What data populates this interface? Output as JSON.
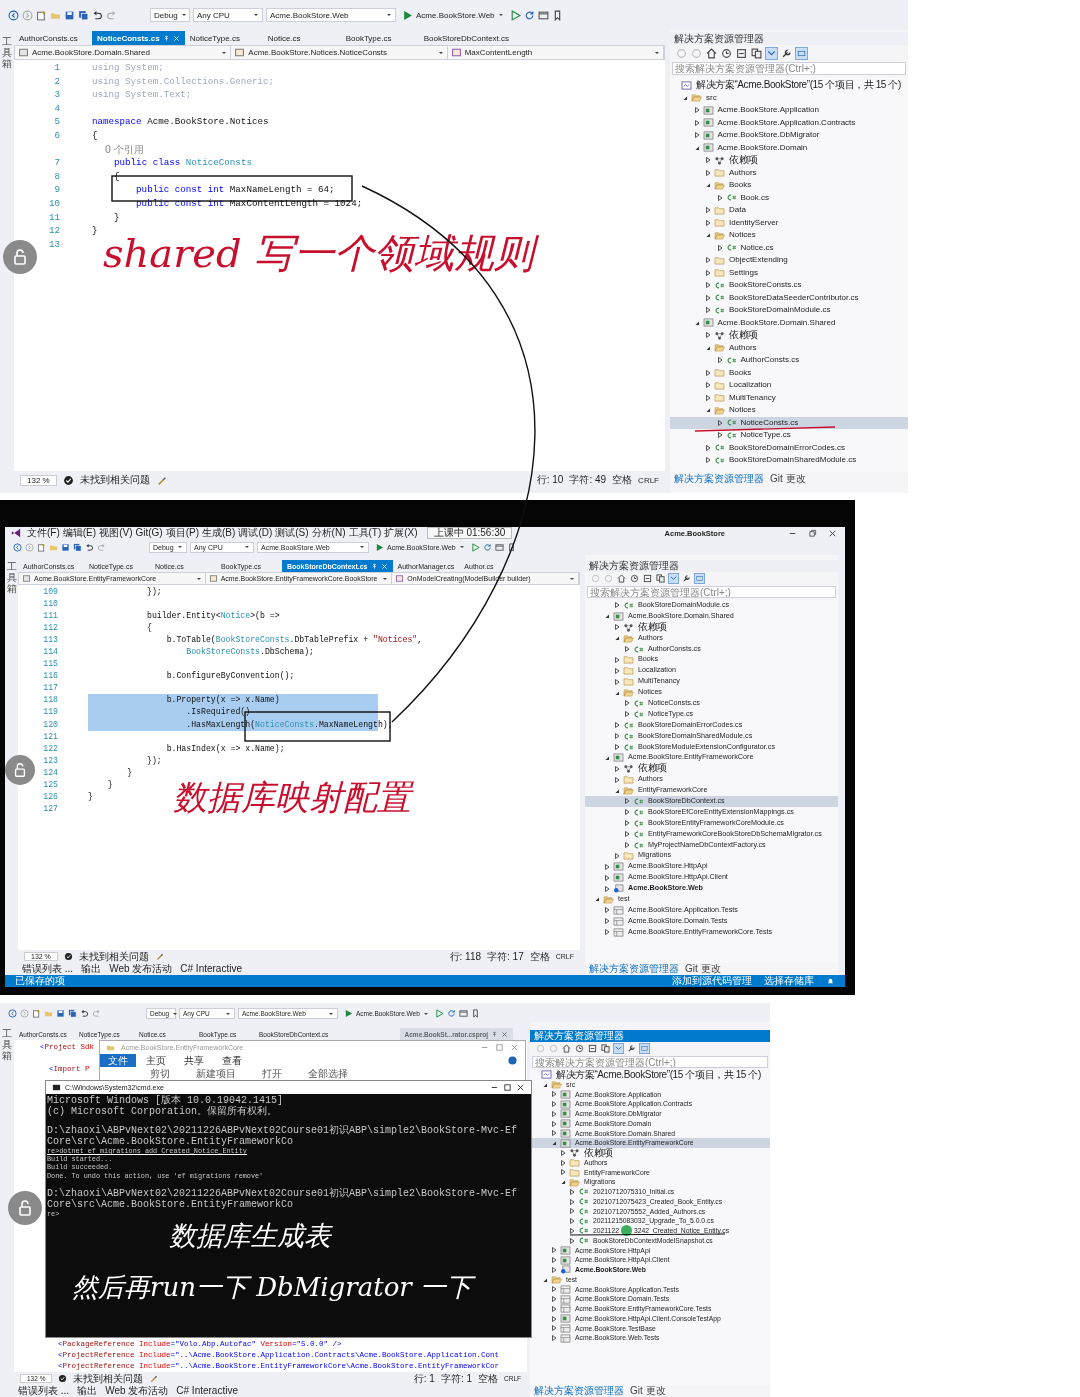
{
  "panels": [
    {
      "toolbar": {
        "config": "Debug",
        "platform": "Any CPU",
        "startup": "Acme.BookStore.Web",
        "run": "Acme.BookStore.Web"
      },
      "side_label": "工具箱",
      "tabs": [
        {
          "label": "AuthorConsts.cs",
          "selected": false
        },
        {
          "label": "NoticeConsts.cs",
          "selected": true
        },
        {
          "label": "NoticeType.cs",
          "selected": false
        },
        {
          "label": "Notice.cs",
          "selected": false
        },
        {
          "label": "BookType.cs",
          "selected": false
        },
        {
          "label": "BookStoreDbContext.cs",
          "selected": false
        }
      ],
      "nav": [
        "Acme.BookStore.Domain.Shared",
        "Acme.BookStore.Notices.NoticeConsts",
        "MaxContentLength"
      ],
      "code": [
        {
          "kind": "code",
          "num": "1",
          "segs": [
            {
              "t": "using System;",
              "kind": "dim"
            }
          ]
        },
        {
          "kind": "code",
          "num": "2",
          "segs": [
            {
              "t": "using System.Collections.Generic;",
              "kind": "dim"
            }
          ]
        },
        {
          "kind": "code",
          "num": "3",
          "segs": [
            {
              "t": "using System.Text;",
              "kind": "dim"
            }
          ]
        },
        {
          "kind": "code",
          "num": "4"
        },
        {
          "kind": "code",
          "num": "5",
          "segs": [
            {
              "t": "namespace",
              "kind": "kw"
            },
            {
              "t": " Acme.BookStore.Notices",
              "kind": "plain"
            }
          ]
        },
        {
          "kind": "code",
          "num": "6",
          "segs": [
            {
              "t": "{",
              "kind": "plain"
            }
          ]
        },
        {
          "kind": "lens",
          "text": "    0 个引用"
        },
        {
          "kind": "code",
          "num": "7",
          "segs": [
            {
              "t": "    public class",
              "kind": "kw"
            },
            {
              "t": " NoticeConsts",
              "kind": "type"
            }
          ]
        },
        {
          "kind": "code",
          "num": "8",
          "segs": [
            {
              "t": "    {",
              "kind": "plain"
            }
          ]
        },
        {
          "kind": "code",
          "num": "9",
          "segs": [
            {
              "t": "        public const int",
              "kind": "kw"
            },
            {
              "t": " MaxNameLength = 64;",
              "kind": "plain"
            }
          ]
        },
        {
          "kind": "code",
          "num": "10",
          "segs": [
            {
              "t": "        public const int",
              "kind": "kw"
            },
            {
              "t": " MaxContentLength = 1024;",
              "kind": "plain"
            }
          ]
        },
        {
          "kind": "code",
          "num": "11",
          "segs": [
            {
              "t": "    }",
              "kind": "plain"
            }
          ]
        },
        {
          "kind": "code",
          "num": "12",
          "segs": [
            {
              "t": "}",
              "kind": "plain"
            }
          ]
        },
        {
          "kind": "code",
          "num": "13"
        }
      ],
      "status": {
        "zoom": "132 %",
        "issues": "未找到相关问题",
        "line": "行: 10",
        "col": "字符: 49",
        "indent": "空格",
        "eol": "CRLF"
      },
      "explorer": {
        "title": "解决方案资源管理器",
        "active": false,
        "search": {
          "placeholder": "搜索解决方案资源管理器(Ctrl+;)"
        },
        "tree": [
          {
            "label": "解决方案“Acme.BookStore”(15 个项目，共 15 个)",
            "kind": "solution",
            "selected": false,
            "children": [
              {
                "label": "src",
                "kind": "folder",
                "expanded": true,
                "selected": false,
                "children": [
                  {
                    "label": "Acme.BookStore.Application",
                    "kind": "project",
                    "expanded": false,
                    "selected": false
                  },
                  {
                    "label": "Acme.BookStore.Application.Contracts",
                    "kind": "project",
                    "expanded": false,
                    "selected": false
                  },
                  {
                    "label": "Acme.BookStore.DbMigrator",
                    "kind": "project",
                    "expanded": false,
                    "selected": false
                  },
                  {
                    "label": "Acme.BookStore.Domain",
                    "kind": "project",
                    "expanded": true,
                    "selected": false,
                    "children": [
                      {
                        "label": "依赖项",
                        "kind": "deps",
                        "expanded": false,
                        "selected": false
                      },
                      {
                        "label": "Authors",
                        "kind": "folder",
                        "expanded": false,
                        "selected": false
                      },
                      {
                        "label": "Books",
                        "kind": "folder",
                        "expanded": true,
                        "selected": false,
                        "children": [
                          {
                            "label": "Book.cs",
                            "kind": "cs",
                            "expanded": false,
                            "selected": false
                          }
                        ]
                      },
                      {
                        "label": "Data",
                        "kind": "folder",
                        "expanded": false,
                        "selected": false
                      },
                      {
                        "label": "IdentityServer",
                        "kind": "folder",
                        "expanded": false,
                        "selected": false
                      },
                      {
                        "label": "Notices",
                        "kind": "folder",
                        "expanded": true,
                        "selected": false,
                        "children": [
                          {
                            "label": "Notice.cs",
                            "kind": "cs",
                            "expanded": false,
                            "selected": false
                          }
                        ]
                      },
                      {
                        "label": "ObjectExtending",
                        "kind": "folder",
                        "expanded": false,
                        "selected": false
                      },
                      {
                        "label": "Settings",
                        "kind": "folder",
                        "expanded": false,
                        "selected": false
                      },
                      {
                        "label": "BookStoreConsts.cs",
                        "kind": "cs",
                        "expanded": false,
                        "selected": false
                      },
                      {
                        "label": "BookStoreDataSeederContributor.cs",
                        "kind": "cs",
                        "expanded": false,
                        "selected": false
                      },
                      {
                        "label": "BookStoreDomainModule.cs",
                        "kind": "cs",
                        "expanded": false,
                        "selected": false
                      }
                    ]
                  },
                  {
                    "label": "Acme.BookStore.Domain.Shared",
                    "kind": "project",
                    "expanded": true,
                    "selected": false,
                    "children": [
                      {
                        "label": "依赖项",
                        "kind": "deps",
                        "expanded": false,
                        "selected": false
                      },
                      {
                        "label": "Authors",
                        "kind": "folder",
                        "expanded": true,
                        "selected": false,
                        "children": [
                          {
                            "label": "AuthorConsts.cs",
                            "kind": "cs",
                            "expanded": false,
                            "selected": false
                          }
                        ]
                      },
                      {
                        "label": "Books",
                        "kind": "folder",
                        "expanded": false,
                        "selected": false
                      },
                      {
                        "label": "Localization",
                        "kind": "folder",
                        "expanded": false,
                        "selected": false
                      },
                      {
                        "label": "MultiTenancy",
                        "kind": "folder",
                        "expanded": false,
                        "selected": false
                      },
                      {
                        "label": "Notices",
                        "kind": "folder",
                        "expanded": true,
                        "selected": false,
                        "children": [
                          {
                            "label": "NoticeConsts.cs",
                            "kind": "cs",
                            "expanded": false,
                            "selected": true
                          },
                          {
                            "label": "NoticeType.cs",
                            "kind": "cs",
                            "expanded": false,
                            "selected": false
                          }
                        ]
                      },
                      {
                        "label": "BookStoreDomainErrorCodes.cs",
                        "kind": "cs",
                        "expanded": false,
                        "selected": false
                      },
                      {
                        "label": "BookStoreDomainSharedModule.cs",
                        "kind": "cs",
                        "expanded": false,
                        "selected": false
                      }
                    ]
                  }
                ]
              }
            ]
          }
        ],
        "tabs": [
          {
            "label": "解决方案资源管理器",
            "selected": true
          },
          {
            "label": "Git 更改",
            "selected": false
          }
        ]
      },
      "handwriting": "shared 写一个领域规则"
    },
    {
      "title_bar": {
        "menu": [
          "文件(F)",
          "编辑(E)",
          "视图(V)",
          "Git(G)",
          "项目(P)",
          "生成(B)",
          "调试(D)",
          "测试(S)",
          "分析(N)",
          "工具(T)",
          "扩展(X)"
        ],
        "timer": "上课中 01:56:30",
        "title": "Acme.BookStore"
      },
      "toolbar": {
        "config": "Debug",
        "platform": "Any CPU",
        "startup": "Acme.BookStore.Web",
        "run": "Acme.BookStore.Web"
      },
      "side_label": "工具箱",
      "tabs": [
        {
          "label": "AuthorConsts.cs",
          "selected": false
        },
        {
          "label": "NoticeType.cs",
          "selected": false
        },
        {
          "label": "Notice.cs",
          "selected": false
        },
        {
          "label": "BookType.cs",
          "selected": false
        },
        {
          "label": "BookStoreDbContext.cs",
          "selected": true
        },
        {
          "label": "AuthorManager.cs",
          "selected": false
        },
        {
          "label": "Author.cs",
          "selected": false
        }
      ],
      "nav": [
        "Acme.BookStore.EntityFrameworkCore",
        "Acme.BookStore.EntityFrameworkCore.BookStore",
        "OnModelCreating(ModelBuilder builder)"
      ],
      "code": [
        {
          "kind": "code",
          "num": "109",
          "highlighted": false,
          "segs": [
            {
              "t": "            });",
              "kind": "plain"
            }
          ]
        },
        {
          "kind": "code",
          "num": "110",
          "highlighted": false
        },
        {
          "kind": "code",
          "num": "111",
          "highlighted": false,
          "segs": [
            {
              "t": "            builder.Entity<",
              "kind": "plain"
            },
            {
              "t": "Notice",
              "kind": "type"
            },
            {
              "t": ">(b =>",
              "kind": "plain"
            }
          ]
        },
        {
          "kind": "code",
          "num": "112",
          "highlighted": false,
          "segs": [
            {
              "t": "            {",
              "kind": "plain"
            }
          ]
        },
        {
          "kind": "code",
          "num": "113",
          "highlighted": false,
          "segs": [
            {
              "t": "                b.ToTable(",
              "kind": "plain"
            },
            {
              "t": "BookStoreConsts",
              "kind": "type"
            },
            {
              "t": ".DbTablePrefix + ",
              "kind": "plain"
            },
            {
              "t": "\"Notices\"",
              "kind": "str"
            },
            {
              "t": ",",
              "kind": "plain"
            }
          ]
        },
        {
          "kind": "code",
          "num": "114",
          "highlighted": false,
          "segs": [
            {
              "t": "                    BookStoreConsts",
              "kind": "type"
            },
            {
              "t": ".DbSchema);",
              "kind": "plain"
            }
          ]
        },
        {
          "kind": "code",
          "num": "115",
          "highlighted": false
        },
        {
          "kind": "code",
          "num": "116",
          "highlighted": false,
          "segs": [
            {
              "t": "                b.ConfigureByConvention();",
              "kind": "plain"
            }
          ]
        },
        {
          "kind": "code",
          "num": "117",
          "highlighted": false
        },
        {
          "kind": "code",
          "num": "118",
          "highlighted": true,
          "segs": [
            {
              "t": "                b.Property(x => x.Name)",
              "kind": "plain"
            }
          ]
        },
        {
          "kind": "code",
          "num": "119",
          "highlighted": true,
          "segs": [
            {
              "t": "                    .IsRequired()",
              "kind": "plain"
            }
          ]
        },
        {
          "kind": "code",
          "num": "120",
          "highlighted": true,
          "segs": [
            {
              "t": "                    .HasMaxLength(",
              "kind": "plain"
            },
            {
              "t": "NoticeConsts",
              "kind": "type"
            },
            {
              "t": ".MaxNameLength);",
              "kind": "plain"
            }
          ]
        },
        {
          "kind": "code",
          "num": "121",
          "highlighted": false
        },
        {
          "kind": "code",
          "num": "122",
          "highlighted": false,
          "segs": [
            {
              "t": "                b.HasIndex(x => x.Name);",
              "kind": "plain"
            }
          ]
        },
        {
          "kind": "code",
          "num": "123",
          "highlighted": false,
          "segs": [
            {
              "t": "            });",
              "kind": "plain"
            }
          ]
        },
        {
          "kind": "code",
          "num": "124",
          "highlighted": false,
          "segs": [
            {
              "t": "        }",
              "kind": "plain"
            }
          ]
        },
        {
          "kind": "code",
          "num": "125",
          "highlighted": false,
          "segs": [
            {
              "t": "    }",
              "kind": "plain"
            }
          ]
        },
        {
          "kind": "code",
          "num": "126",
          "highlighted": false,
          "segs": [
            {
              "t": "}",
              "kind": "plain"
            }
          ]
        },
        {
          "kind": "code",
          "num": "127",
          "highlighted": false
        }
      ],
      "status": {
        "zoom": "132 %",
        "issues": "未找到相关问题",
        "line": "行: 118",
        "col": "字符: 17",
        "indent": "空格",
        "eol": "CRLF"
      },
      "tool_tabs": [
        {
          "label": "错误列表 ...",
          "selected": false
        },
        {
          "label": "输出",
          "selected": false
        },
        {
          "label": "Web 发布活动",
          "selected": false
        },
        {
          "label": "C# Interactive",
          "selected": false
        }
      ],
      "explorer": {
        "title": "解决方案资源管理器",
        "active": false,
        "search": {
          "placeholder": "搜索解决方案资源管理器(Ctrl+;)"
        },
        "tree": [
          {
            "kind": "continued",
            "children": [
              {
                "kind": "continued",
                "children": [
                  {
                    "label": "BookStoreDomainModule.cs",
                    "kind": "cs",
                    "expanded": false,
                    "selected": false
                  }
                ]
              },
              {
                "label": "Acme.BookStore.Domain.Shared",
                "kind": "project",
                "expanded": true,
                "selected": false,
                "children": [
                  {
                    "label": "依赖项",
                    "kind": "deps",
                    "expanded": false,
                    "selected": false
                  },
                  {
                    "label": "Authors",
                    "kind": "folder",
                    "expanded": true,
                    "selected": false,
                    "children": [
                      {
                        "label": "AuthorConsts.cs",
                        "kind": "cs",
                        "expanded": false,
                        "selected": false
                      }
                    ]
                  },
                  {
                    "label": "Books",
                    "kind": "folder",
                    "expanded": false,
                    "selected": false
                  },
                  {
                    "label": "Localization",
                    "kind": "folder",
                    "expanded": false,
                    "selected": false
                  },
                  {
                    "label": "MultiTenancy",
                    "kind": "folder",
                    "expanded": false,
                    "selected": false
                  },
                  {
                    "label": "Notices",
                    "kind": "folder",
                    "expanded": true,
                    "selected": false,
                    "children": [
                      {
                        "label": "NoticeConsts.cs",
                        "kind": "cs",
                        "expanded": false,
                        "selected": false
                      },
                      {
                        "label": "NoticeType.cs",
                        "kind": "cs",
                        "expanded": false,
                        "selected": false
                      }
                    ]
                  },
                  {
                    "label": "BookStoreDomainErrorCodes.cs",
                    "kind": "cs",
                    "expanded": false,
                    "selected": false
                  },
                  {
                    "label": "BookStoreDomainSharedModule.cs",
                    "kind": "cs",
                    "expanded": false,
                    "selected": false
                  },
                  {
                    "label": "BookStoreModuleExtensionConfigurator.cs",
                    "kind": "cs",
                    "expanded": false,
                    "selected": false
                  }
                ]
              },
              {
                "label": "Acme.BookStore.EntityFrameworkCore",
                "kind": "project",
                "expanded": true,
                "selected": false,
                "children": [
                  {
                    "label": "依赖项",
                    "kind": "deps",
                    "expanded": false,
                    "selected": false
                  },
                  {
                    "label": "Authors",
                    "kind": "folder",
                    "expanded": false,
                    "selected": false
                  },
                  {
                    "label": "EntityFrameworkCore",
                    "kind": "folder",
                    "expanded": true,
                    "selected": false,
                    "children": [
                      {
                        "label": "BookStoreDbContext.cs",
                        "kind": "cs",
                        "expanded": false,
                        "selected": true
                      },
                      {
                        "label": "BookStoreEfCoreEntityExtensionMappings.cs",
                        "kind": "cs",
                        "expanded": false,
                        "selected": false
                      },
                      {
                        "label": "BookStoreEntityFrameworkCoreModule.cs",
                        "kind": "cs",
                        "expanded": false,
                        "selected": false
                      },
                      {
                        "label": "EntityFrameworkCoreBookStoreDbSchemaMigrator.cs",
                        "kind": "cs",
                        "expanded": false,
                        "selected": false
                      },
                      {
                        "label": "MyProjectNameDbContextFactory.cs",
                        "kind": "cs",
                        "expanded": false,
                        "selected": false
                      }
                    ]
                  },
                  {
                    "label": "Migrations",
                    "kind": "folder",
                    "expanded": false,
                    "selected": false
                  }
                ]
              },
              {
                "label": "Acme.BookStore.HttpApi",
                "kind": "project",
                "expanded": false,
                "selected": false
              },
              {
                "label": "Acme.BookStore.HttpApi.Client",
                "kind": "project",
                "expanded": false,
                "selected": false
              },
              {
                "label": "Acme.BookStore.Web",
                "kind": "web",
                "expanded": false,
                "selected": false
              }
            ]
          },
          {
            "label": "test",
            "kind": "folder",
            "expanded": true,
            "selected": false,
            "children": [
              {
                "label": "Acme.BookStore.Application.Tests",
                "kind": "test",
                "expanded": false,
                "selected": false
              },
              {
                "label": "Acme.BookStore.Domain.Tests",
                "kind": "test",
                "expanded": false,
                "selected": false
              },
              {
                "label": "Acme.BookStore.EntityFrameworkCore.Tests",
                "kind": "test",
                "expanded": false,
                "selected": false
              }
            ]
          }
        ],
        "tabs": [
          {
            "label": "解决方案资源管理器",
            "selected": true
          },
          {
            "label": "Git 更改",
            "selected": false
          }
        ]
      },
      "status_bar": {
        "left": "已保存的项",
        "right": [
          "添加到源代码管理",
          "选择存储库"
        ]
      },
      "handwriting": "数据库映射配置"
    },
    {
      "toolbar": {
        "config": "Debug",
        "platform": "Any CPU",
        "startup": "Acme.BookStore.Web",
        "run": "Acme.BookStore.Web"
      },
      "side_label": "工具箱",
      "tabs": [
        {
          "label": "AuthorConsts.cs",
          "selected": false
        },
        {
          "label": "NoticeType.cs",
          "selected": false
        },
        {
          "label": "Notice.cs",
          "selected": false
        },
        {
          "label": "BookType.cs",
          "selected": false
        },
        {
          "label": "BookStoreDbContext.cs",
          "selected": false
        },
        {
          "label": "Acme.BookSt...rator.csproj",
          "selected": true
        }
      ],
      "code": [
        {
          "kind": "code",
          "segs": [
            {
              "t": "<",
              "kind": "kw"
            },
            {
              "t": "Project",
              "kind": "str"
            },
            {
              "t": " Sdk",
              "kind": "attr"
            }
          ]
        },
        {
          "kind": "code"
        },
        {
          "kind": "code",
          "segs": [
            {
              "t": "  <",
              "kind": "kw"
            },
            {
              "t": "Import",
              "kind": "str"
            },
            {
              "t": " P",
              "kind": "attr"
            }
          ]
        }
      ],
      "code_end": [
        {
          "kind": "code",
          "segs": [
            {
              "t": "    <",
              "kind": "kw"
            },
            {
              "t": "PackageReference",
              "kind": "str"
            },
            {
              "t": " Include",
              "kind": "attr"
            },
            {
              "t": "=\"Volo.Abp.Autofac\"",
              "kind": "kw"
            },
            {
              "t": " Version",
              "kind": "attr"
            },
            {
              "t": "=\"5.0.0\"",
              "kind": "kw"
            },
            {
              "t": " />",
              "kind": "kw"
            }
          ]
        },
        {
          "kind": "code",
          "segs": [
            {
              "t": "    <",
              "kind": "kw"
            },
            {
              "t": "ProjectReference",
              "kind": "str"
            },
            {
              "t": " Include",
              "kind": "attr"
            },
            {
              "t": "=\"..\\Acme.BookStore.Application.Contracts\\Acme.BookStore.Application.Cont",
              "kind": "kw"
            }
          ]
        },
        {
          "kind": "code",
          "segs": [
            {
              "t": "    <",
              "kind": "kw"
            },
            {
              "t": "ProjectReference",
              "kind": "str"
            },
            {
              "t": " Include",
              "kind": "attr"
            },
            {
              "t": "=\"..\\Acme.BookStore.EntityFrameworkCore\\Acme.BookStore.EntityFrameworkCor",
              "kind": "kw"
            }
          ]
        }
      ],
      "status": {
        "zoom": "132 %",
        "issues": "未找到相关问题",
        "line": "行: 1",
        "col": "字符: 1",
        "indent": "空格",
        "eol": "CRLF"
      },
      "tool_tabs": [
        {
          "label": "错误列表 ...",
          "selected": false
        },
        {
          "label": "输出",
          "selected": false
        },
        {
          "label": "Web 发布活动",
          "selected": false
        },
        {
          "label": "C# Interactive",
          "selected": false
        }
      ],
      "file_window": {
        "title": "Acme.BookStore.EntityFrameworkCore",
        "ribbon_tabs": [
          {
            "label": "文件",
            "selected": true
          },
          {
            "label": "主页",
            "selected": false
          },
          {
            "label": "共享",
            "selected": false
          },
          {
            "label": "查看",
            "selected": false
          }
        ],
        "commands": [
          "剪切",
          "新建项目",
          "打开",
          "全部选择"
        ]
      },
      "console": {
        "title": "C:\\Windows\\System32\\cmd.exe",
        "paragraphs": [
          [
            {
              "text": "Microsoft Windows [版本 10.0.19042.1415]",
              "underlined": false
            },
            {
              "text": "(c) Microsoft Corporation。保留所有权利。",
              "underlined": false
            }
          ],
          [
            {
              "text": "D:\\zhaoxi\\ABPvNext02\\20211226ABPvNext02Course01初识ABP\\simple2\\BookStore-Mvc-EfCore\\src\\Acme.BookStore.EntityFrameworkCo",
              "underlined": false
            },
            {
              "text": "re>dotnet ef migrations add Created_Notice_Entity",
              "underlined": true
            },
            {
              "text": "Build started...",
              "underlined": false
            },
            {
              "text": "Build succeeded.",
              "underlined": false
            },
            {
              "text": "Done. To undo this action, use 'ef migrations remove'",
              "underlined": false
            }
          ],
          [
            {
              "text": "D:\\zhaoxi\\ABPvNext02\\20211226ABPvNext02Course01初识ABP\\simple2\\BookStore-Mvc-EfCore\\src\\Acme.BookStore.EntityFrameworkCo",
              "underlined": false
            },
            {
              "text": "re>",
              "underlined": false
            }
          ]
        ],
        "handwriting": [
          "数据库生成表",
          "然后再run一下 DbMigrator 一下"
        ]
      },
      "explorer": {
        "title": "解决方案资源管理器",
        "active": true,
        "search": {
          "placeholder": "搜索解决方案资源管理器(Ctrl+;)"
        },
        "tree": [
          {
            "label": "解决方案“Acme.BookStore”(15 个项目，共 15 个)",
            "kind": "solution",
            "selected": false,
            "children": [
              {
                "label": "src",
                "kind": "folder",
                "expanded": true,
                "selected": false,
                "children": [
                  {
                    "label": "Acme.BookStore.Application",
                    "kind": "project",
                    "expanded": false,
                    "selected": false
                  },
                  {
                    "label": "Acme.BookStore.Application.Contracts",
                    "kind": "project",
                    "expanded": false,
                    "selected": false
                  },
                  {
                    "label": "Acme.BookStore.DbMigrator",
                    "kind": "project",
                    "expanded": false,
                    "selected": false
                  },
                  {
                    "label": "Acme.BookStore.Domain",
                    "kind": "project",
                    "expanded": false,
                    "selected": false
                  },
                  {
                    "label": "Acme.BookStore.Domain.Shared",
                    "kind": "project",
                    "expanded": false,
                    "selected": false
                  },
                  {
                    "label": "Acme.BookStore.EntityFrameworkCore",
                    "kind": "project",
                    "expanded": true,
                    "selected": true,
                    "children": [
                      {
                        "label": "依赖项",
                        "kind": "deps",
                        "expanded": false,
                        "selected": false
                      },
                      {
                        "label": "Authors",
                        "kind": "folder",
                        "expanded": false,
                        "selected": false
                      },
                      {
                        "label": "EntityFrameworkCore",
                        "kind": "folder",
                        "expanded": false,
                        "selected": false
                      },
                      {
                        "label": "Migrations",
                        "kind": "folder",
                        "expanded": true,
                        "selected": false,
                        "children": [
                          {
                            "label": "20210712075310_Initial.cs",
                            "kind": "cs",
                            "expanded": false,
                            "selected": false
                          },
                          {
                            "label": "20210712075423_Created_Book_Entity.cs",
                            "kind": "cs",
                            "expanded": false,
                            "selected": false
                          },
                          {
                            "label": "20210712075552_Added_Authors.cs",
                            "kind": "cs",
                            "expanded": false,
                            "selected": false
                          },
                          {
                            "label": "20211215083032_Upgrade_To_5.0.0.cs",
                            "kind": "cs",
                            "expanded": false,
                            "selected": false
                          },
                          {
                            "label": "2021122",
                            "tail": "3242_Created_Notice_Entity.cs",
                            "kind": "cs",
                            "expanded": false,
                            "selected": false
                          },
                          {
                            "label": "BookStoreDbContextModelSnapshot.cs",
                            "kind": "cs",
                            "expanded": false,
                            "selected": false
                          }
                        ]
                      }
                    ]
                  },
                  {
                    "label": "Acme.BookStore.HttpApi",
                    "kind": "project",
                    "expanded": false,
                    "selected": false
                  },
                  {
                    "label": "Acme.BookStore.HttpApi.Client",
                    "kind": "project",
                    "expanded": false,
                    "selected": false
                  },
                  {
                    "label": "Acme.BookStore.Web",
                    "kind": "web",
                    "expanded": false,
                    "selected": false
                  }
                ]
              },
              {
                "label": "test",
                "kind": "folder",
                "expanded": true,
                "selected": false,
                "children": [
                  {
                    "label": "Acme.BookStore.Application.Tests",
                    "kind": "test",
                    "expanded": false,
                    "selected": false
                  },
                  {
                    "label": "Acme.BookStore.Domain.Tests",
                    "kind": "test",
                    "expanded": false,
                    "selected": false
                  },
                  {
                    "label": "Acme.BookStore.EntityFrameworkCore.Tests",
                    "kind": "test",
                    "expanded": false,
                    "selected": false
                  },
                  {
                    "label": "Acme.BookStore.HttpApi.Client.ConsoleTestApp",
                    "kind": "project",
                    "expanded": false,
                    "selected": false
                  },
                  {
                    "label": "Acme.BookStore.TestBase",
                    "kind": "test",
                    "expanded": false,
                    "selected": false
                  },
                  {
                    "label": "Acme.BookStore.Web.Tests",
                    "kind": "test",
                    "expanded": false,
                    "selected": false
                  }
                ]
              }
            ]
          }
        ],
        "tabs": [
          {
            "label": "解决方案资源管理器",
            "selected": true
          },
          {
            "label": "Git 更改",
            "selected": false
          }
        ]
      }
    }
  ]
}
